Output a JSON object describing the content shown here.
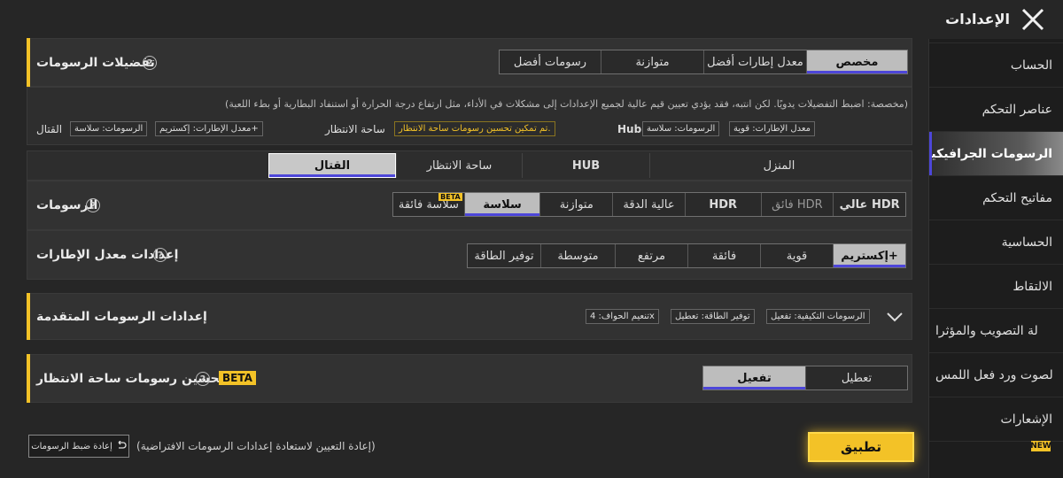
{
  "header": {
    "title": "الإعدادات",
    "close_icon": "close-icon"
  },
  "sidebar": {
    "items": [
      {
        "label": "الحساب",
        "active": false
      },
      {
        "label": "عناصر التحكم",
        "active": false
      },
      {
        "label": "الرسومات الجرافيكية",
        "active": true
      },
      {
        "label": "مفاتيح التحكم",
        "active": false
      },
      {
        "label": "الحساسية",
        "active": false
      },
      {
        "label": "الالتقاط",
        "active": false
      },
      {
        "label": "لة التصويب والمؤثرا",
        "active": false
      },
      {
        "label": "لصوت ورد فعل اللمس",
        "active": false
      },
      {
        "label": "الإشعارات",
        "active": false
      }
    ],
    "new_badge": "NEW"
  },
  "graphics_prefs": {
    "label": "تفضيلات الرسومات",
    "options": [
      "مخصص",
      "معدل إطارات أفضل",
      "متوازنة",
      "رسومات أفضل"
    ],
    "selected": "مخصص",
    "description": "(مخصصة: اضبط التفضيلات يدويًا. لكن انتبه، فقد يؤدي تعيين قيم عالية لجميع الإعدادات إلى مشكلات في الأداء، مثل ارتفاع درجة الحرارة أو استنفاد البطارية أو بطء اللعبة)",
    "summary": {
      "battle_label": "القتال",
      "battle_graphics": "الرسومات: سلاسة",
      "battle_fps": "معدل الإطارات: إكستريم+",
      "lobby_label": "ساحة الانتظار",
      "lobby_notice": "تم تمكين تحسين رسومات ساحة الانتظار.",
      "hub_label": "Hub",
      "hub_graphics": "الرسومات: سلاسة",
      "hub_fps": "معدل الإطارات: قوية"
    }
  },
  "scene_tabs": {
    "items": [
      "القتال",
      "ساحة الانتظار",
      "HUB",
      "المنزل"
    ],
    "selected": "القتال"
  },
  "graphics": {
    "label": "الرسومات",
    "options": [
      "عالي HDR",
      "فائق HDR",
      "HDR",
      "عالية الدقة",
      "متوازنة",
      "سلاسة",
      "سلاسة فائقة"
    ],
    "selected": "سلاسة",
    "beta_tag": "BETA"
  },
  "frame_rate": {
    "label": "إعدادات معدل الإطارات",
    "options": [
      "إكستريم+",
      "قوية",
      "فائقة",
      "مرتفع",
      "متوسطة",
      "توفير الطاقة"
    ],
    "selected": "إكستريم+"
  },
  "advanced": {
    "label": "إعدادات الرسومات المتقدمة",
    "chips": [
      "الرسومات التكيفية: تفعيل",
      "توفير الطاقة: تعطيل",
      "تنعيم الحواف: 4x"
    ]
  },
  "lobby_enhance": {
    "label": "تحسين رسومات ساحة الانتظار",
    "beta": "BETA",
    "options": [
      "تعطيل",
      "تفعيل"
    ],
    "selected": "تفعيل"
  },
  "footer": {
    "apply_label": "تطبيق",
    "reset_label": "إعادة ضبط الرسومات",
    "reset_desc": "(إعادة التعيين لاستعادة إعدادات الرسومات الافتراضية)"
  }
}
